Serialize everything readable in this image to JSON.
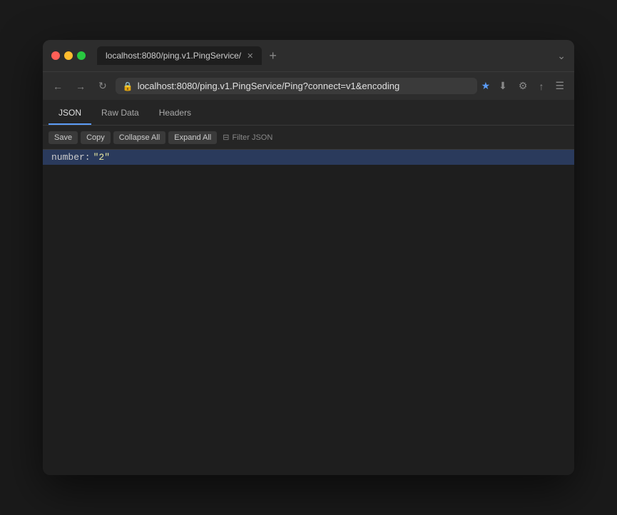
{
  "window": {
    "tab_title": "localhost:8080/ping.v1.PingService/",
    "url": "localhost:8080/ping.v1.PingService/Ping?connect=v1&encoding",
    "new_tab_icon": "+"
  },
  "viewer_tabs": [
    {
      "label": "JSON",
      "active": true
    },
    {
      "label": "Raw Data",
      "active": false
    },
    {
      "label": "Headers",
      "active": false
    }
  ],
  "toolbar": {
    "save_label": "Save",
    "copy_label": "Copy",
    "collapse_all_label": "Collapse All",
    "expand_all_label": "Expand All",
    "filter_label": "Filter JSON"
  },
  "json_data": {
    "key": "number:",
    "value": "\"2\""
  },
  "icons": {
    "back": "←",
    "forward": "→",
    "reload": "↻",
    "lock": "🔒",
    "star": "★",
    "download": "⬇",
    "wrench": "🔧",
    "share": "⬆",
    "menu": "☰",
    "chevron": "⌄",
    "filter": "⊟"
  }
}
